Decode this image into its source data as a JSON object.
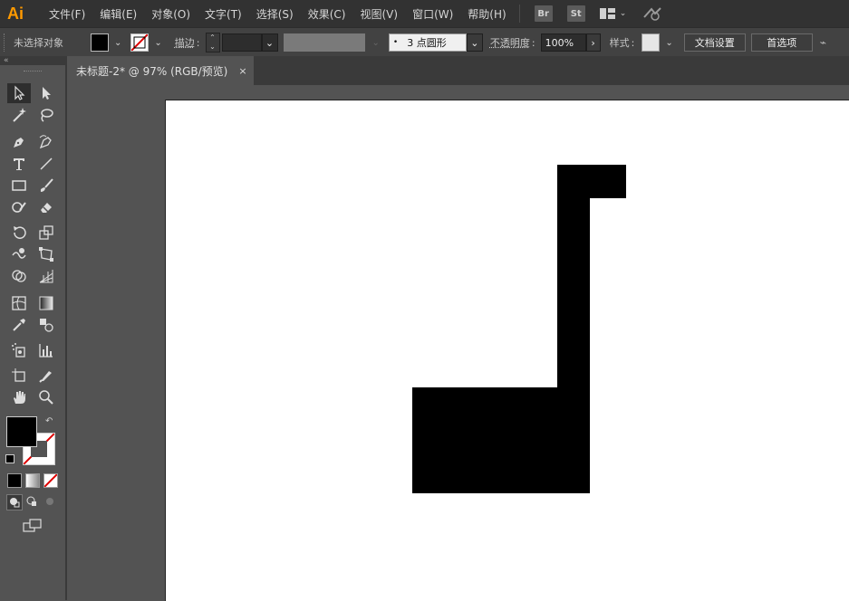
{
  "app": {
    "logo": "Ai",
    "accent": "#ff9a00"
  },
  "menu": [
    "文件(F)",
    "编辑(E)",
    "对象(O)",
    "文字(T)",
    "选择(S)",
    "效果(C)",
    "视图(V)",
    "窗口(W)",
    "帮助(H)"
  ],
  "app_buttons": {
    "bridge": "Br",
    "stock": "St"
  },
  "control": {
    "selection_status": "未选择对象",
    "stroke_label": "描边",
    "brush_dot": "•",
    "brush_value": "3 点圆形",
    "opacity_label": "不透明度",
    "opacity_value": "100%",
    "style_label": "样式",
    "doc_setup_button": "文档设置",
    "preferences_button": "首选项"
  },
  "document": {
    "tab_title": "未标题-2* @ 97% (RGB/预览)",
    "close": "×"
  },
  "colors": {
    "fill": "#000000",
    "stroke": "none",
    "artwork": "#000000"
  }
}
